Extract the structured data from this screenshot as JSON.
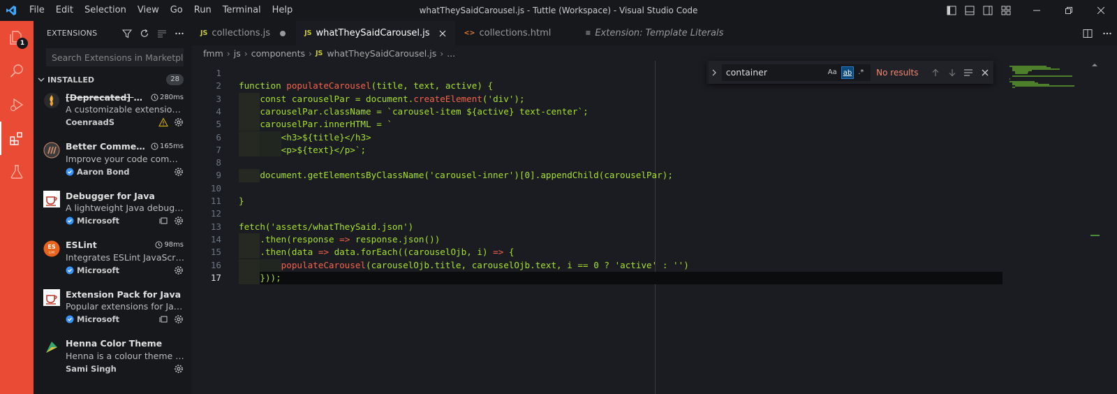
{
  "window": {
    "title": "whatTheySaidCarousel.js - Tuttle (Workspace) - Visual Studio Code"
  },
  "menu": [
    "File",
    "Edit",
    "Selection",
    "View",
    "Go",
    "Run",
    "Terminal",
    "Help"
  ],
  "activity": {
    "explorer_badge": "1"
  },
  "sidebar": {
    "title": "EXTENSIONS",
    "search_placeholder": "Search Extensions in Marketplace",
    "installed_label": "INSTALLED",
    "installed_count": "28",
    "extensions": [
      {
        "name": "[Deprecated] Bracket Pair Colorizer",
        "time": "280ms",
        "desc": "A customizable extension for colorizing matching brackets",
        "publisher": "CoenraadS",
        "verified": false,
        "deprecated": true,
        "warning": true
      },
      {
        "name": "Better Comments",
        "time": "165ms",
        "desc": "Improve your code commenting by annotating with alert, informational, TODOs, and more!",
        "publisher": "Aaron Bond",
        "verified": true
      },
      {
        "name": "Debugger for Java",
        "time": "",
        "desc": "A lightweight Java debugger for Visual Studio Code",
        "publisher": "Microsoft",
        "verified": true,
        "sync": true
      },
      {
        "name": "ESLint",
        "time": "98ms",
        "desc": "Integrates ESLint JavaScript into VS Code.",
        "publisher": "Microsoft",
        "verified": true
      },
      {
        "name": "Extension Pack for Java",
        "time": "",
        "desc": "Popular extensions for Java development",
        "publisher": "Microsoft",
        "verified": true,
        "sync": true
      },
      {
        "name": "Henna Color Theme",
        "time": "",
        "desc": "Henna is a colour theme inspired by the henna plant",
        "publisher": "Sami Singh",
        "verified": false
      }
    ]
  },
  "tabs": [
    {
      "label": "collections.js",
      "icon": "JS",
      "modified": true,
      "active": false
    },
    {
      "label": "whatTheySaidCarousel.js",
      "icon": "JS",
      "modified": false,
      "active": true
    },
    {
      "label": "collections.html",
      "icon": "<>",
      "modified": false,
      "active": false
    },
    {
      "label": "Extension: Template Literals",
      "icon": "≡",
      "modified": false,
      "active": false,
      "italic": true
    }
  ],
  "breadcrumb": [
    "fmm",
    "js",
    "components",
    "whatTheySaidCarousel.js",
    "..."
  ],
  "find": {
    "query": "container",
    "match_case": "Aa",
    "whole_word": "ab",
    "regex": ".*",
    "result": "No results"
  },
  "code": {
    "current_line": 17,
    "lines": [
      "",
      "function populateCarousel(title, text, active) {",
      "    const carouselPar = document.createElement('div');",
      "    carouselPar.className = `carousel-item ${active} text-center`;",
      "    carouselPar.innerHTML = `",
      "        <h3>${title}</h3>",
      "        <p>${text}</p>`;",
      "",
      "    document.getElementsByClassName('carousel-inner')[0].appendChild(carouselPar);",
      "",
      "}",
      "",
      "fetch('assets/whatTheySaid.json')",
      "    .then(response => response.json())",
      "    .then(data => data.forEach((carouselOjb, i) => {",
      "        populateCarousel(carouselOjb.title, carouselOjb.text, i == 0 ? 'active' : '')",
      "    }));"
    ]
  }
}
